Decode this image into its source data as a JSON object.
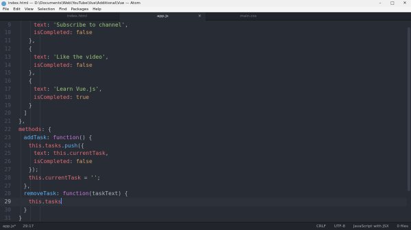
{
  "window": {
    "title": "index.html — D:\\Documents\\Web\\YouTube\\Vue\\Additional\\Vue — Atom",
    "controls": [
      "–",
      "□",
      "✕"
    ]
  },
  "menu": [
    "File",
    "Edit",
    "View",
    "Selection",
    "Find",
    "Packages",
    "Help"
  ],
  "tabs": [
    {
      "label": "index.html",
      "active": false
    },
    {
      "label": "app.js",
      "active": true
    },
    {
      "label": "main.css",
      "active": false
    }
  ],
  "editor": {
    "current_line": "29",
    "lines": [
      {
        "num": "9",
        "tokens": [
          [
            "prop",
            "text"
          ],
          [
            "txt",
            ": "
          ],
          [
            "str",
            "'Subscribe to channel'"
          ],
          [
            "txt",
            ","
          ]
        ]
      },
      {
        "num": "10",
        "tokens": [
          [
            "prop",
            "isCompleted"
          ],
          [
            "txt",
            ": "
          ],
          [
            "const",
            "false"
          ]
        ]
      },
      {
        "num": "11",
        "tokens": [
          [
            "txt",
            "},"
          ]
        ]
      },
      {
        "num": "12",
        "tokens": [
          [
            "txt",
            "{"
          ]
        ]
      },
      {
        "num": "13",
        "tokens": [
          [
            "prop",
            "text"
          ],
          [
            "txt",
            ": "
          ],
          [
            "str",
            "'Like the video'"
          ],
          [
            "txt",
            ","
          ]
        ]
      },
      {
        "num": "14",
        "tokens": [
          [
            "prop",
            "isCompleted"
          ],
          [
            "txt",
            ": "
          ],
          [
            "const",
            "false"
          ]
        ]
      },
      {
        "num": "15",
        "tokens": [
          [
            "txt",
            "},"
          ]
        ]
      },
      {
        "num": "16",
        "tokens": [
          [
            "txt",
            "{"
          ]
        ]
      },
      {
        "num": "17",
        "tokens": [
          [
            "prop",
            "text"
          ],
          [
            "txt",
            ": "
          ],
          [
            "str",
            "'Learn Vue.js'"
          ],
          [
            "txt",
            ","
          ]
        ]
      },
      {
        "num": "18",
        "tokens": [
          [
            "prop",
            "isCompleted"
          ],
          [
            "txt",
            ": "
          ],
          [
            "const",
            "true"
          ]
        ]
      },
      {
        "num": "19",
        "tokens": [
          [
            "txt",
            "}"
          ]
        ]
      },
      {
        "num": "20",
        "tokens": [
          [
            "txt",
            "]"
          ]
        ]
      },
      {
        "num": "21",
        "tokens": [
          [
            "txt",
            "},"
          ]
        ]
      },
      {
        "num": "22",
        "tokens": [
          [
            "prop",
            "methods"
          ],
          [
            "txt",
            ": {"
          ]
        ]
      },
      {
        "num": "23",
        "tokens": [
          [
            "fn",
            "addTask"
          ],
          [
            "txt",
            ": "
          ],
          [
            "kw",
            "function"
          ],
          [
            "txt",
            "() {"
          ]
        ]
      },
      {
        "num": "24",
        "tokens": [
          [
            "prop",
            "this"
          ],
          [
            "txt",
            "."
          ],
          [
            "prop",
            "tasks"
          ],
          [
            "txt",
            "."
          ],
          [
            "fn",
            "push"
          ],
          [
            "txt",
            "({"
          ]
        ]
      },
      {
        "num": "25",
        "tokens": [
          [
            "prop",
            "text"
          ],
          [
            "txt",
            ": "
          ],
          [
            "prop",
            "this"
          ],
          [
            "txt",
            "."
          ],
          [
            "prop",
            "currentTask"
          ],
          [
            "txt",
            ","
          ]
        ]
      },
      {
        "num": "26",
        "tokens": [
          [
            "prop",
            "isCompleted"
          ],
          [
            "txt",
            ": "
          ],
          [
            "const",
            "false"
          ]
        ]
      },
      {
        "num": "27",
        "tokens": [
          [
            "txt",
            "});"
          ]
        ]
      },
      {
        "num": "28",
        "tokens": [
          [
            "prop",
            "this"
          ],
          [
            "txt",
            "."
          ],
          [
            "prop",
            "currentTask"
          ],
          [
            "txt",
            " = "
          ],
          [
            "str",
            "''"
          ],
          [
            "txt",
            ";"
          ]
        ]
      },
      {
        "num": "29",
        "tokens": [
          [
            "txt",
            "},"
          ]
        ]
      },
      {
        "num": "29",
        "tokens": [
          [
            "fn",
            "removeTask"
          ],
          [
            "txt",
            ": "
          ],
          [
            "kw",
            "function"
          ],
          [
            "txt",
            "(taskText) {"
          ]
        ]
      },
      {
        "num": "29",
        "tokens": [
          [
            "prop",
            "this"
          ],
          [
            "txt",
            "."
          ],
          [
            "prop",
            "tasks"
          ]
        ],
        "cursor": true
      },
      {
        "num": "30",
        "tokens": [
          [
            "txt",
            "}"
          ]
        ]
      },
      {
        "num": "31",
        "tokens": [
          [
            "txt",
            "}"
          ]
        ]
      }
    ],
    "display_numbers": [
      "9",
      "10",
      "11",
      "12",
      "13",
      "14",
      "15",
      "16",
      "17",
      "18",
      "19",
      "20",
      "21",
      "22",
      "23",
      "24",
      "25",
      "26",
      "27",
      "28",
      "27",
      "28",
      "29",
      "30",
      "31"
    ]
  },
  "status": {
    "file": "app.js*",
    "position": "29:17",
    "line_ending": "CRLF",
    "encoding": "UTF-8",
    "grammar": "JavaScript with JSX",
    "files": "0 files"
  },
  "colors": {
    "background": "#282c34",
    "string": "#98c379",
    "keyword": "#c678dd",
    "function": "#61afef",
    "constant": "#d19a66",
    "property": "#e06c75"
  }
}
